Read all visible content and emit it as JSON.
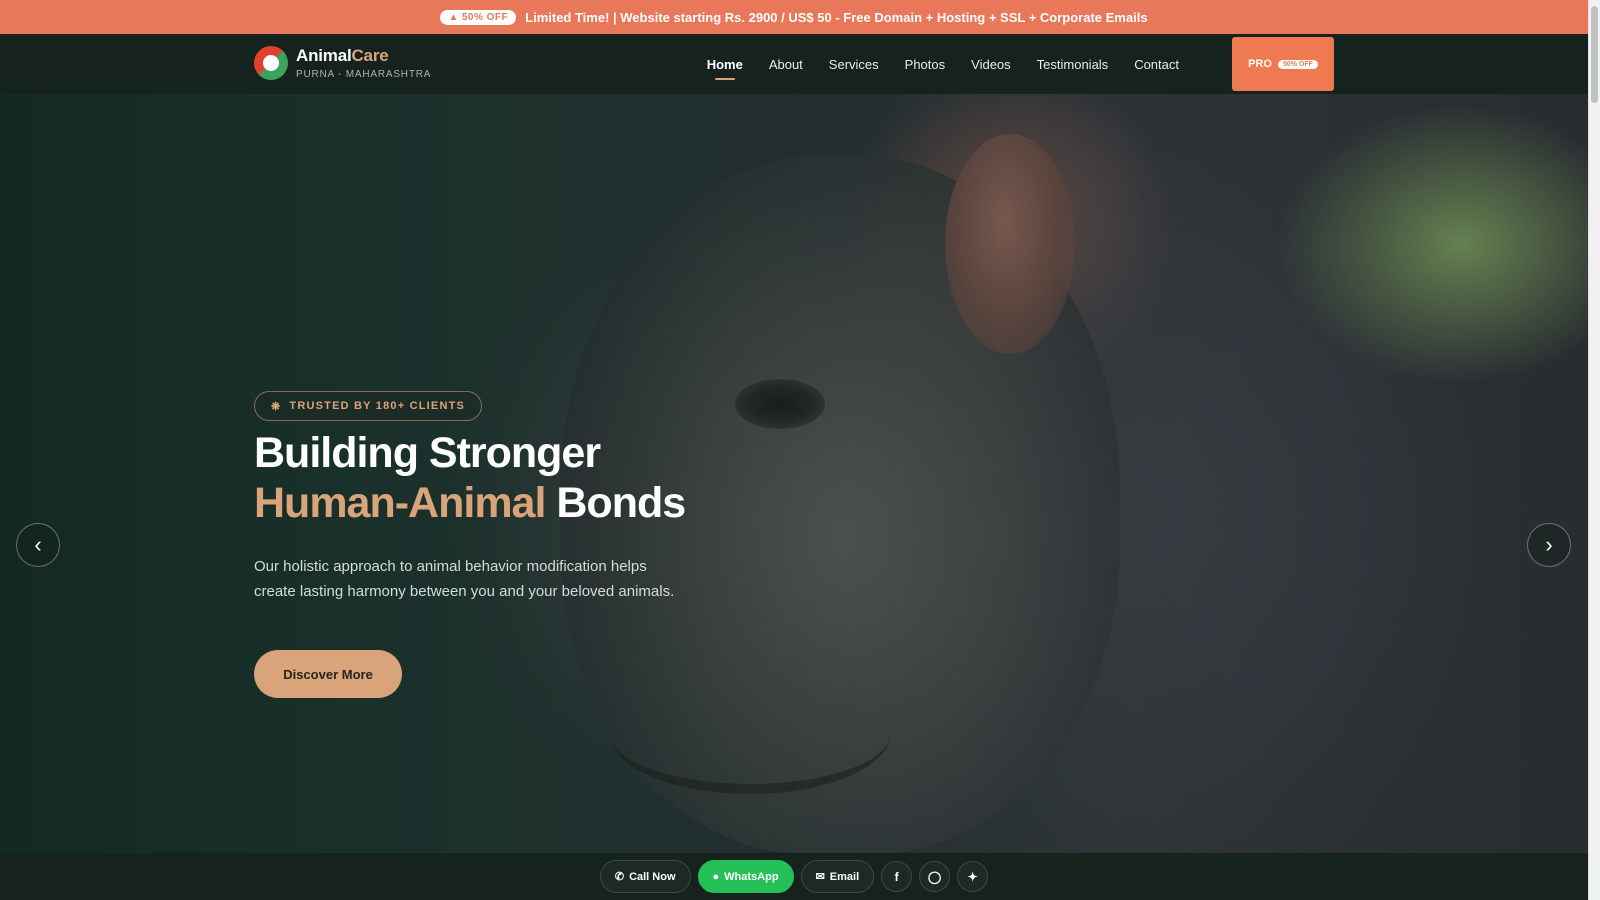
{
  "promo": {
    "badge_icon": "flame-icon",
    "badge": "50% OFF",
    "text": "Limited Time! | Website starting Rs. 2900 / US$ 50 - Free Domain + Hosting + SSL + Corporate Emails"
  },
  "brand": {
    "name_part1": "Animal",
    "name_part2": "Care",
    "location": "PURNA - MAHARASHTRA"
  },
  "nav": {
    "items": [
      "Home",
      "About",
      "Services",
      "Photos",
      "Videos",
      "Testimonials",
      "Contact"
    ],
    "active": "Home",
    "pro_label": "PRO",
    "pro_badge": "50% OFF"
  },
  "hero": {
    "trust_badge": "TRUSTED BY 180+ CLIENTS",
    "headline_line1": "Building Stronger",
    "headline_highlight": "Human-Animal",
    "headline_end": "Bonds",
    "description": "Our holistic approach to animal behavior modification helps create lasting harmony between you and your beloved animals.",
    "cta": "Discover More",
    "prev_arrow": "‹",
    "next_arrow": "›"
  },
  "bottom_bar": {
    "call": "Call Now",
    "whatsapp": "WhatsApp",
    "email": "Email",
    "socials": [
      "facebook-icon",
      "instagram-icon",
      "twitter-icon"
    ]
  },
  "colors": {
    "promo_bg": "#e9785a",
    "header_bg": "#16221d",
    "accent": "#d9a47a",
    "pro_bg": "#ef7a52",
    "whatsapp": "#25c158"
  }
}
